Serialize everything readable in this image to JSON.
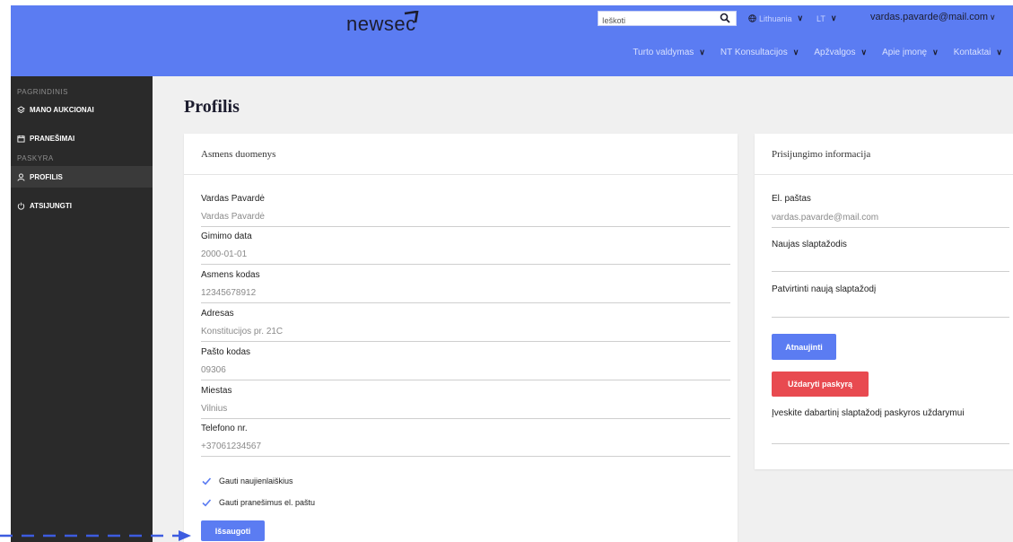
{
  "colors": {
    "brand": "#5b7cf2",
    "sidebar": "#2a2a2a",
    "danger": "#e84a50"
  },
  "header": {
    "logo": "newsec",
    "search_placeholder": "Ieškoti",
    "country": "Lithuania",
    "language": "LT",
    "user_email": "vardas.pavarde@mail.com",
    "nav": [
      "Turto valdymas",
      "NT Konsultacijos",
      "Apžvalgos",
      "Apie įmonę",
      "Kontaktai"
    ]
  },
  "sidebar": {
    "section_main": "PAGRINDINIS",
    "section_account": "PASKYRA",
    "items": [
      {
        "label": "MANO AUKCIONAI",
        "icon": "layers-icon"
      },
      {
        "label": "PRANEŠIMAI",
        "icon": "calendar-icon"
      },
      {
        "label": "PROFILIS",
        "icon": "user-icon"
      },
      {
        "label": "ATSIJUNGTI",
        "icon": "power-icon"
      }
    ]
  },
  "main": {
    "title": "Profilis",
    "personal": {
      "heading": "Asmens duomenys",
      "fields": [
        {
          "label": "Vardas Pavardė",
          "value": "Vardas Pavardė"
        },
        {
          "label": "Gimimo data",
          "value": "2000-01-01"
        },
        {
          "label": "Asmens kodas",
          "value": "12345678912"
        },
        {
          "label": "Adresas",
          "value": "Konstitucijos pr. 21C"
        },
        {
          "label": "Pašto kodas",
          "value": "09306"
        },
        {
          "label": "Miestas",
          "value": "Vilnius"
        },
        {
          "label": "Telefono nr.",
          "value": "+37061234567"
        }
      ],
      "checks": [
        "Gauti naujienlaiškius",
        "Gauti pranešimus el. paštu"
      ],
      "save_label": "Išsaugoti"
    },
    "login": {
      "heading": "Prisijungimo informacija",
      "email_label": "El. paštas",
      "email_value": "vardas.pavarde@mail.com",
      "new_password_label": "Naujas slaptažodis",
      "confirm_password_label": "Patvirtinti naują slaptažodį",
      "update_label": "Atnaujinti",
      "close_label": "Uždaryti paskyrą",
      "close_hint": "Įveskite dabartinį slaptažodį paskyros uždarymui"
    }
  }
}
